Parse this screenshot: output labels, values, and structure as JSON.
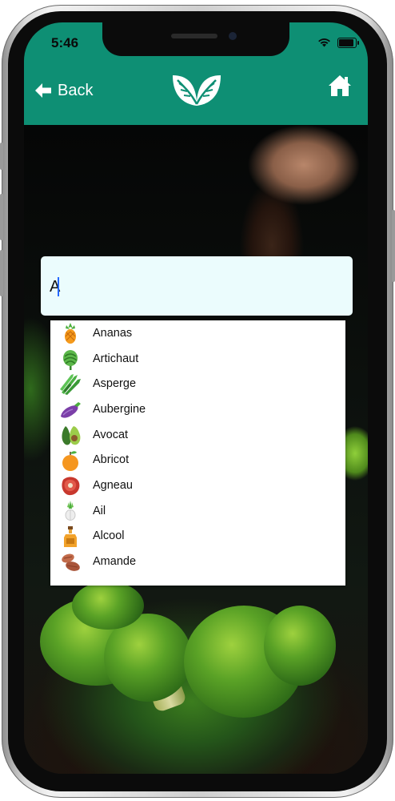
{
  "status_bar": {
    "time": "5:46"
  },
  "nav": {
    "back_label": "Back",
    "logo_icon": "leaf-logo-icon",
    "home_icon": "home-icon",
    "accent_color": "#0e8f74"
  },
  "search": {
    "value": "A"
  },
  "suggestions": [
    {
      "label": "Ananas",
      "icon": "pineapple-icon"
    },
    {
      "label": "Artichaut",
      "icon": "artichoke-icon"
    },
    {
      "label": "Asperge",
      "icon": "asparagus-icon"
    },
    {
      "label": "Aubergine",
      "icon": "eggplant-icon"
    },
    {
      "label": "Avocat",
      "icon": "avocado-icon"
    },
    {
      "label": "Abricot",
      "icon": "apricot-icon"
    },
    {
      "label": "Agneau",
      "icon": "lamb-meat-icon"
    },
    {
      "label": "Ail",
      "icon": "garlic-icon"
    },
    {
      "label": "Alcool",
      "icon": "alcohol-bottle-icon"
    },
    {
      "label": "Amande",
      "icon": "almond-icon"
    }
  ]
}
